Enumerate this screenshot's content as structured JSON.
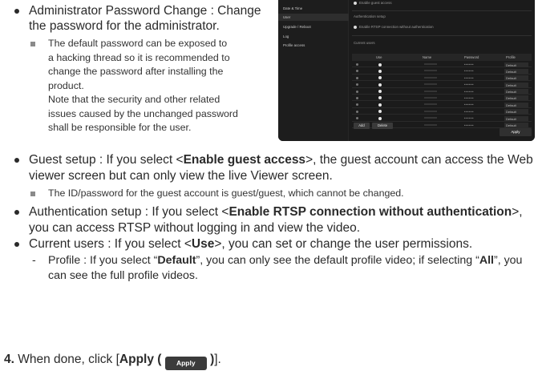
{
  "admin_section": {
    "heading": "Administrator Password Change : Change the password for the administrator.",
    "note_lines": [
      "The default password can be exposed to",
      "a hacking thread so it is recommended to",
      "change the password after installing the",
      "product.",
      "Note that the security and other related",
      "issues caused by the unchanged password",
      "shall be responsible for the user."
    ]
  },
  "screenshot": {
    "sidebar_items": [
      "Date & Time",
      "User",
      "Upgrade / Reboot",
      "Log",
      "Profile access"
    ],
    "selected_item": "User",
    "guest_label": "Enable guest access",
    "auth_heading": "Authentication setup",
    "rtsp_label": "Enable RTSP connection without authentication",
    "users_heading": "Current users",
    "columns": [
      "Use",
      "Name",
      "Password",
      "Profile"
    ],
    "rows": [
      {
        "password": "••••••",
        "profile": "Default"
      },
      {
        "password": "••••••",
        "profile": "Default"
      },
      {
        "password": "••••••",
        "profile": "Default"
      },
      {
        "password": "••••••",
        "profile": "Default"
      },
      {
        "password": "••••••",
        "profile": "Default"
      },
      {
        "password": "••••••",
        "profile": "Default"
      },
      {
        "password": "••••••",
        "profile": "Default"
      },
      {
        "password": "••••••",
        "profile": "Default"
      },
      {
        "password": "••••••",
        "profile": "Default"
      },
      {
        "password": "••••••",
        "profile": "Default"
      }
    ],
    "add_label": "Add",
    "delete_label": "Delete",
    "apply_label": "Apply"
  },
  "guest": {
    "prefix": "Guest setup : If you select <",
    "bold": "Enable guest access",
    "suffix": ">, the guest account can access the Web viewer screen but can only view the live Viewer screen.",
    "note": "The ID/password for the guest account is guest/guest, which cannot be changed."
  },
  "auth": {
    "prefix": "Authentication setup : If you select <",
    "bold": "Enable RTSP connection without authentication",
    "suffix": ">, you can access RTSP without logging in and view the video."
  },
  "users": {
    "prefix": "Current users : If you select <",
    "bold": "Use",
    "suffix": ">, you can set or change the user permissions."
  },
  "profile": {
    "dash": "-",
    "p1": "Profile : If you select “",
    "b1": "Default",
    "p2": "”, you can only see the default profile video; if selecting “",
    "b2": "All",
    "p3": "”, you can see the full profile videos."
  },
  "step": {
    "number": "4.",
    "text": "When done, click [",
    "bold": "Apply (",
    "button": "Apply",
    "close": ")",
    "end": "]."
  }
}
